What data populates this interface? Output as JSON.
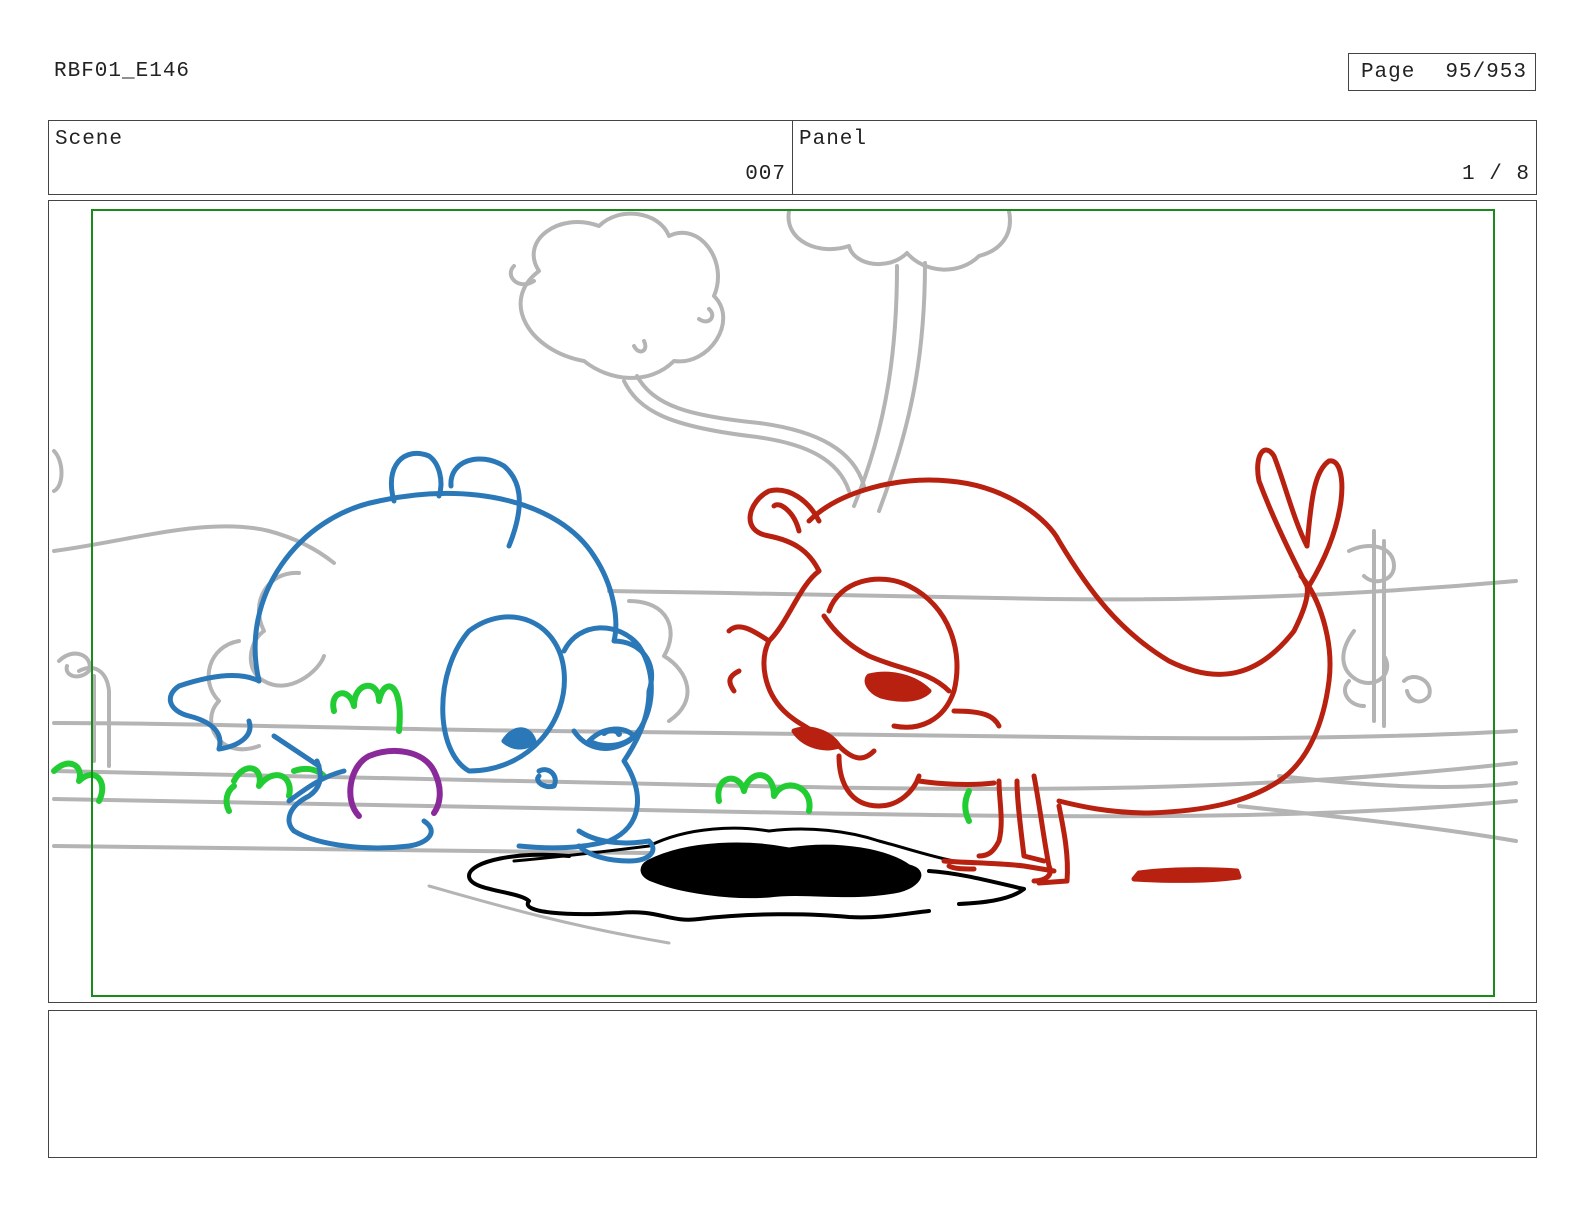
{
  "header": {
    "production_code": "RBF01_E146",
    "page_label": "Page",
    "page_value": "95/953"
  },
  "info": {
    "scene_label": "Scene",
    "scene_value": "007",
    "panel_label": "Panel",
    "panel_value": "1 / 8"
  },
  "notes": {
    "text": ""
  },
  "colors": {
    "background_sketch": "#b4b4b4",
    "blue_character": "#2a78b8",
    "red_character": "#b82010",
    "grass": "#22cc33",
    "tongue": "#8a2a9a",
    "hole": "#000000",
    "safe_frame": "#1a8a1a"
  }
}
